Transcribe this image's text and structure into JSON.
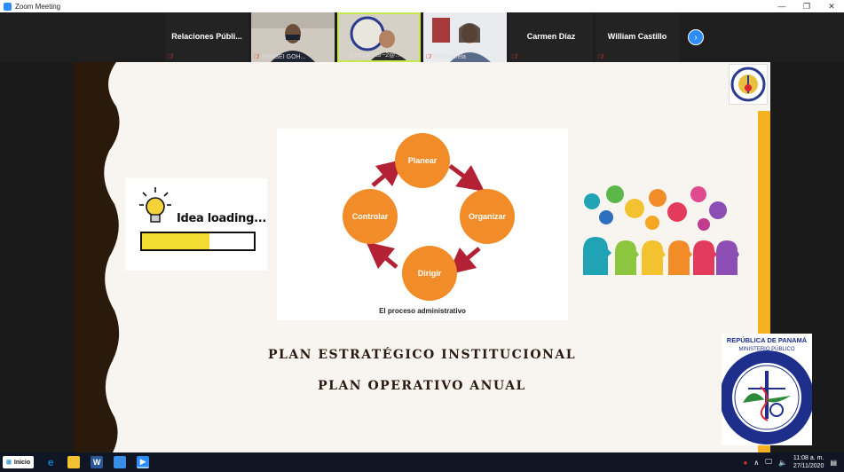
{
  "window": {
    "title": "Zoom Meeting",
    "minimize": "—",
    "restore": "❐",
    "close": "✕"
  },
  "participants": [
    {
      "name": "Relaciones  Públi...",
      "video": false
    },
    {
      "name": "SENSEI GOH...",
      "video": true
    },
    {
      "name": "jose.pachar~2@...",
      "video": true
    },
    {
      "name": "Vera Varela",
      "video": true
    },
    {
      "name": "Carmen Díaz",
      "video": false
    },
    {
      "name": "William Castillo",
      "video": false
    }
  ],
  "next_arrow": "›",
  "slide": {
    "idea_text": "Idea loading...",
    "idea_progress": 0.6,
    "diagram": {
      "nodes": [
        "Planear",
        "Organizar",
        "Dirigir",
        "Controlar"
      ],
      "caption": "El proceso administrativo"
    },
    "heading1": "PLAN ESTRATÉGICO INSTITUCIONAL",
    "heading2": "PLAN OPERATIVO ANUAL",
    "seal": {
      "top_line1": "REPÚBLICA DE PANAMÁ",
      "top_line2": "MINISTERIO PÚBLICO",
      "ring_text": "INSTITUTO DE MEDICINA LEGAL Y CIENCIAS FORENSES"
    }
  },
  "taskbar": {
    "start_label": "Inicio",
    "time": "11:08 a. m.",
    "date": "27/11/2020",
    "colors": {
      "zoom": "#2d8cff",
      "word": "#2b5797",
      "edge": "#0a7cc8"
    }
  }
}
